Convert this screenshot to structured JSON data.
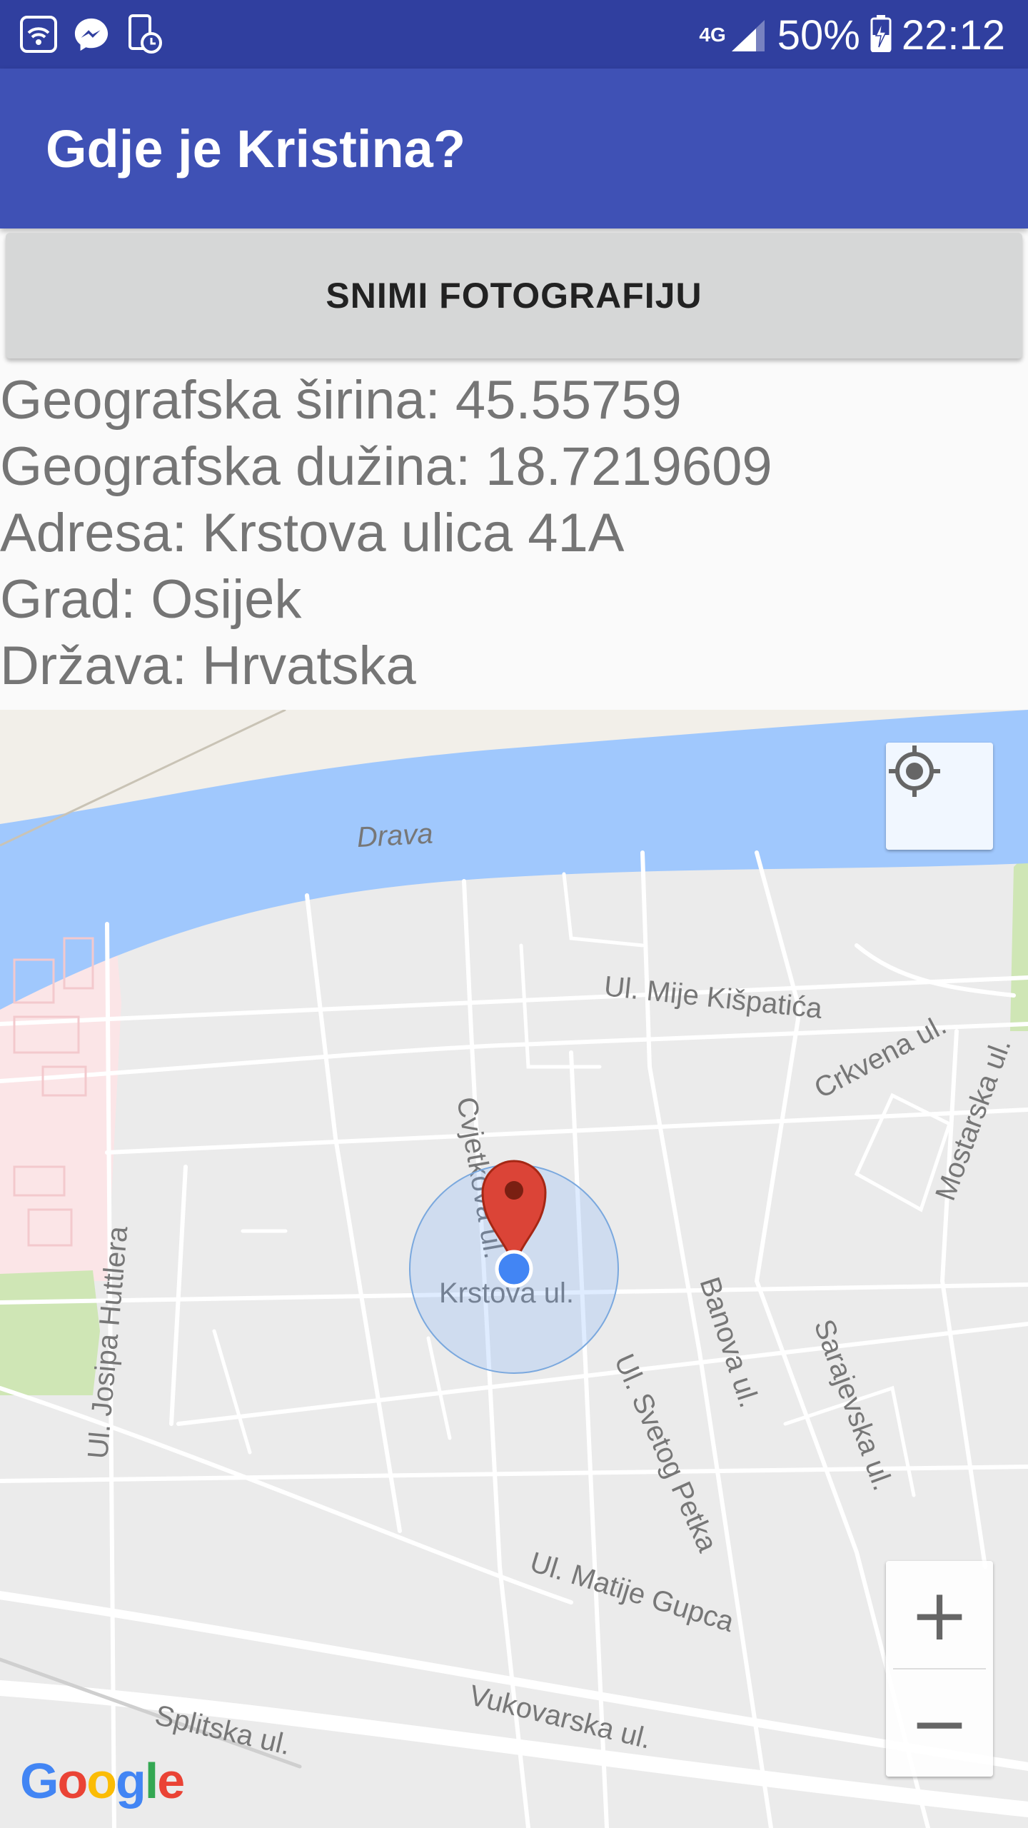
{
  "status_bar": {
    "icons_left": [
      "wifi-icon",
      "messenger-icon",
      "screen-time-icon"
    ],
    "network": "4G",
    "battery": "50%",
    "time": "22:12"
  },
  "app_bar": {
    "title": "Gdje je Kristina?"
  },
  "button": {
    "label": "SNIMI FOTOGRAFIJU"
  },
  "info": {
    "latitude": "Geografska širina: 45.55759",
    "longitude": "Geografska dužina: 18.7219609",
    "address": "Adresa: Krstova ulica 41A",
    "city": "Grad: Osijek",
    "country": "Država: Hrvatska"
  },
  "map": {
    "labels": {
      "river": "Drava",
      "mije": "Ul. Mije Kišpatića",
      "crkvena": "Crkvena ul.",
      "mostarska": "Mostarska ul.",
      "cvjetkova": "Cvjetkova ul.",
      "krstova": "Krstova ul.",
      "banova": "Banova ul.",
      "sarajevska": "Sarajevska ul.",
      "huttlera": "Ul. Josipa Huttlera",
      "svetog_petka": "Ul. Svetog Petka",
      "matije_gupca": "Ul. Matije Gupca",
      "vukovarska": "Vukovarska ul.",
      "splitska": "Splitska ul."
    },
    "zoom_in": "+",
    "zoom_out": "−",
    "logo": "Google"
  },
  "colors": {
    "status_bar": "#303f9f",
    "app_bar": "#3f51b5",
    "water": "#a0c8fd",
    "pin": "#db4437",
    "location_dot": "#4285f4"
  }
}
